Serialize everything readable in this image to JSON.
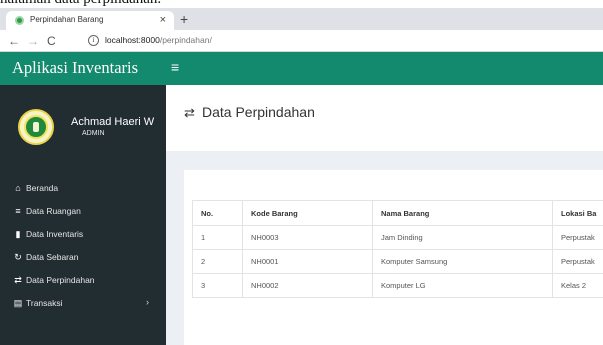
{
  "caption_fragment": "halaman data perpindahan.",
  "browser": {
    "tab_title": "Perpindahan Barang",
    "tab_close": "×",
    "new_tab": "+",
    "back": "←",
    "forward": "→",
    "reload": "C",
    "info_icon": "i",
    "url_host": "localhost:8000",
    "url_path": "/perpindahan/"
  },
  "app": {
    "brand": "Aplikasi Inventaris",
    "menu_toggle": "≡"
  },
  "user": {
    "name": "Achmad Haeri W",
    "role": "ADMIN"
  },
  "sidebar": {
    "items": [
      {
        "label": "Beranda",
        "icon": "⌂"
      },
      {
        "label": "Data Ruangan",
        "icon": "≡"
      },
      {
        "label": "Data Inventaris",
        "icon": "▮"
      },
      {
        "label": "Data Sebaran",
        "icon": "↻"
      },
      {
        "label": "Data Perpindahan",
        "icon": "⇄"
      },
      {
        "label": "Transaksi",
        "icon": "▤",
        "chevron": "›"
      }
    ]
  },
  "page": {
    "title": "Data Perpindahan",
    "title_icon": "⇄"
  },
  "table": {
    "headers": [
      "No.",
      "Kode Barang",
      "Nama Barang",
      "Lokasi Ba"
    ],
    "rows": [
      [
        "1",
        "NH0003",
        "Jam Dinding",
        "Perpustak"
      ],
      [
        "2",
        "NH0001",
        "Komputer Samsung",
        "Perpustak"
      ],
      [
        "3",
        "NH0002",
        "Komputer LG",
        "Kelas 2"
      ]
    ]
  },
  "colors": {
    "brand_green": "#13896d",
    "sidebar_bg": "#222d32",
    "content_bg": "#ecf0f5"
  }
}
